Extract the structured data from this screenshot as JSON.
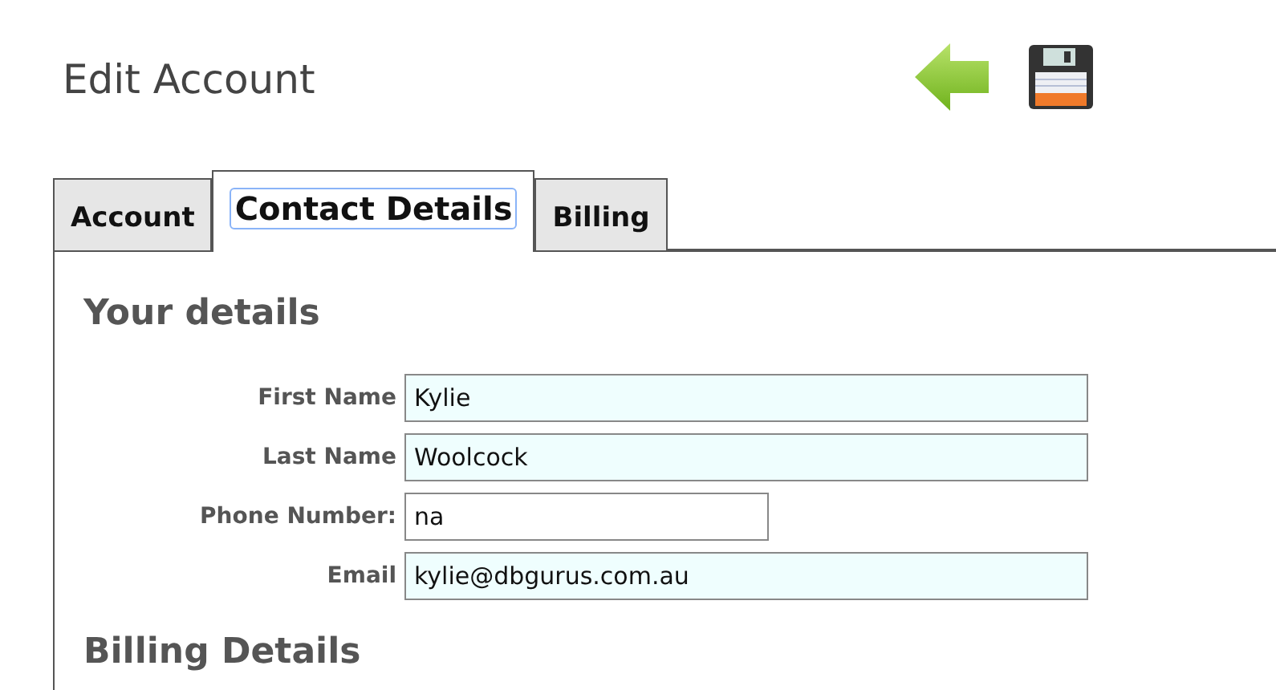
{
  "page": {
    "title": "Edit Account"
  },
  "toolbar": [
    {
      "kind": "back"
    },
    {
      "kind": "save"
    }
  ],
  "tabs": [
    {
      "label": "Account",
      "selected": false
    },
    {
      "label": "Contact Details",
      "selected": true
    },
    {
      "label": "Billing",
      "selected": false
    }
  ],
  "sections": [
    {
      "heading": "Your details",
      "fields": [
        {
          "label": "First Name",
          "value": "Kylie",
          "required": true,
          "kind": "wide"
        },
        {
          "label": "Last Name",
          "value": "Woolcock",
          "required": true,
          "kind": "wide"
        },
        {
          "label": "Phone Number:",
          "value": "na",
          "required": false,
          "kind": "short"
        },
        {
          "label": "Email",
          "value": "kylie@dbgurus.com.au",
          "required": true,
          "kind": "wide"
        }
      ]
    },
    {
      "heading": "Billing Details"
    }
  ]
}
